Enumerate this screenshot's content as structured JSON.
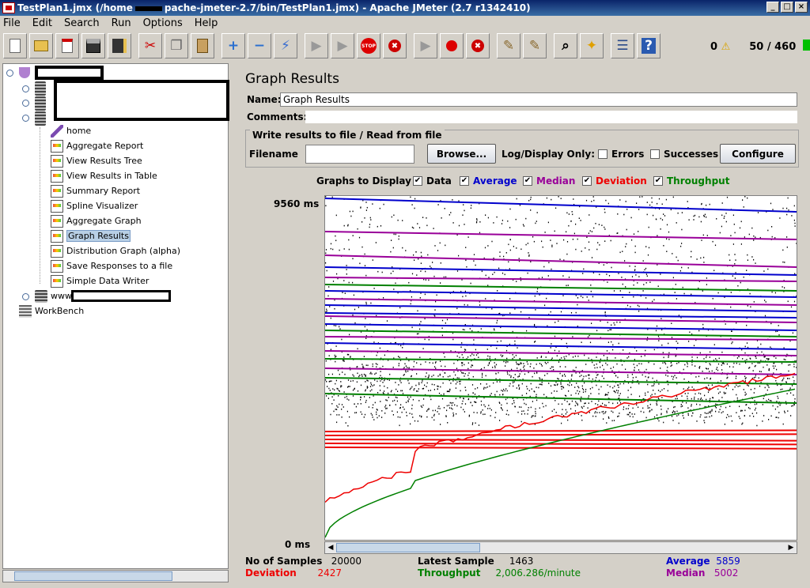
{
  "window": {
    "title_prefix": "TestPlan1.jmx (/home",
    "title_suffix": "pache-jmeter-2.7/bin/TestPlan1.jmx) - Apache JMeter (2.7 r1342410)",
    "controls": [
      "_",
      "□",
      "×"
    ]
  },
  "menu": [
    "File",
    "Edit",
    "Search",
    "Run",
    "Options",
    "Help"
  ],
  "toolbar": {
    "add": "+",
    "remove": "−",
    "stop_label": "STOP",
    "error_count": "0",
    "threads": "50 / 460"
  },
  "tree": {
    "items": [
      {
        "label": "home",
        "icon": "pipette-icon"
      },
      {
        "label": "Aggregate Report",
        "icon": "chart-icon"
      },
      {
        "label": "View Results Tree",
        "icon": "chart-icon"
      },
      {
        "label": "View Results in Table",
        "icon": "chart-icon"
      },
      {
        "label": "Summary Report",
        "icon": "chart-icon"
      },
      {
        "label": "Spline Visualizer",
        "icon": "chart-icon"
      },
      {
        "label": "Aggregate Graph",
        "icon": "chart-icon"
      },
      {
        "label": "Graph Results",
        "icon": "chart-icon",
        "selected": true
      },
      {
        "label": "Distribution Graph (alpha)",
        "icon": "chart-icon"
      },
      {
        "label": "Save Responses to a file",
        "icon": "chart-icon"
      },
      {
        "label": "Simple Data Writer",
        "icon": "chart-icon"
      }
    ],
    "www_prefix": "www",
    "workbench": "WorkBench"
  },
  "panel": {
    "heading": "Graph Results",
    "name_label": "Name:",
    "name_value": "Graph Results",
    "comments_label": "Comments:",
    "file_legend": "Write results to file / Read from file",
    "filename_label": "Filename",
    "filename_value": "",
    "browse": "Browse...",
    "log_only": "Log/Display Only:",
    "errors": "Errors",
    "successes": "Successes",
    "configure": "Configure",
    "graphs_to_display": "Graphs to Display",
    "checks": {
      "data": "Data",
      "average": "Average",
      "median": "Median",
      "deviation": "Deviation",
      "throughput": "Throughput"
    }
  },
  "colors": {
    "average": "#0000cc",
    "median": "#990099",
    "deviation": "#ee0000",
    "throughput": "#008000",
    "data": "#000000"
  },
  "graph": {
    "y_max_label": "9560 ms",
    "y_min_label": "0 ms"
  },
  "stats": {
    "no_samples_label": "No of Samples",
    "no_samples": "20000",
    "latest_label": "Latest Sample",
    "latest": "1463",
    "average_label": "Average",
    "average": "5859",
    "deviation_label": "Deviation",
    "deviation": "2427",
    "throughput_label": "Throughput",
    "throughput": "2,006.286/minute",
    "median_label": "Median",
    "median": "5002"
  }
}
